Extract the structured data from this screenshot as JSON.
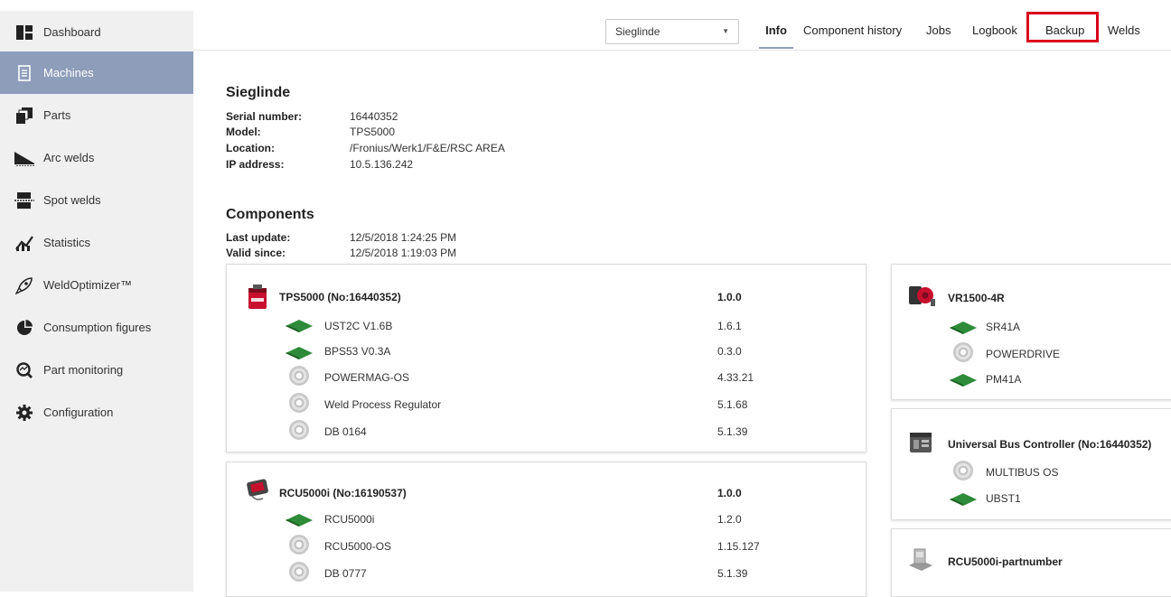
{
  "sidebar": {
    "items": [
      {
        "label": "Dashboard"
      },
      {
        "label": "Machines"
      },
      {
        "label": "Parts"
      },
      {
        "label": "Arc welds"
      },
      {
        "label": "Spot welds"
      },
      {
        "label": "Statistics"
      },
      {
        "label": "WeldOptimizer™"
      },
      {
        "label": "Consumption figures"
      },
      {
        "label": "Part monitoring"
      },
      {
        "label": "Configuration"
      }
    ],
    "active_index": 1
  },
  "topbar": {
    "machine_select": "Sieglinde",
    "tabs": [
      "Info",
      "Component history",
      "Jobs",
      "Logbook",
      "Backup",
      "Welds"
    ],
    "active_tab": "Info",
    "highlighted_tab": "Backup"
  },
  "machine": {
    "name": "Sieglinde",
    "fields": [
      {
        "label": "Serial number:",
        "value": "16440352"
      },
      {
        "label": "Model:",
        "value": "TPS5000"
      },
      {
        "label": "Location:",
        "value": "/Fronius/Werk1/F&E/RSC AREA"
      },
      {
        "label": "IP address:",
        "value": "10.5.136.242"
      }
    ]
  },
  "components": {
    "title": "Components",
    "fields": [
      {
        "label": "Last update:",
        "value": "12/5/2018 1:24:25 PM"
      },
      {
        "label": "Valid since:",
        "value": "12/5/2018 1:19:03 PM"
      }
    ],
    "cards_left": [
      {
        "name": "TPS5000 (No:16440352)",
        "version": "1.0.0",
        "icon": "power-source-icon",
        "items": [
          {
            "name": "UST2C V1.6B",
            "version": "1.6.1",
            "icon": "board-icon"
          },
          {
            "name": "BPS53 V0.3A",
            "version": "0.3.0",
            "icon": "board-icon"
          },
          {
            "name": "POWERMAG-OS",
            "version": "4.33.21",
            "icon": "cd-icon"
          },
          {
            "name": "Weld Process Regulator",
            "version": "5.1.68",
            "icon": "cd-icon"
          },
          {
            "name": "DB 0164",
            "version": "5.1.39",
            "icon": "cd-icon"
          }
        ]
      },
      {
        "name": "RCU5000i (No:16190537)",
        "version": "1.0.0",
        "icon": "remote-control-icon",
        "items": [
          {
            "name": "RCU5000i",
            "version": "1.2.0",
            "icon": "board-icon"
          },
          {
            "name": "RCU5000-OS",
            "version": "1.15.127",
            "icon": "cd-icon"
          },
          {
            "name": "DB 0777",
            "version": "5.1.39",
            "icon": "cd-icon"
          }
        ]
      }
    ],
    "cards_right": [
      {
        "name": "VR1500-4R",
        "icon": "wire-feeder-icon",
        "items": [
          {
            "name": "SR41A",
            "icon": "board-icon"
          },
          {
            "name": "POWERDRIVE",
            "icon": "cd-icon"
          },
          {
            "name": "PM41A",
            "icon": "board-icon"
          }
        ]
      },
      {
        "name": "Universal Bus Controller (No:16440352)",
        "icon": "bus-controller-icon",
        "items": [
          {
            "name": "MULTIBUS OS",
            "icon": "cd-icon"
          },
          {
            "name": "UBST1",
            "icon": "board-icon"
          }
        ]
      },
      {
        "name": "RCU5000i-partnumber",
        "icon": "device-icon",
        "items": []
      }
    ]
  },
  "colors": {
    "sidebar_bg": "#f0f0f0",
    "sidebar_active": "#8e9dba",
    "highlight_red": "#d9001b",
    "board_green": "#2e8b3a"
  }
}
